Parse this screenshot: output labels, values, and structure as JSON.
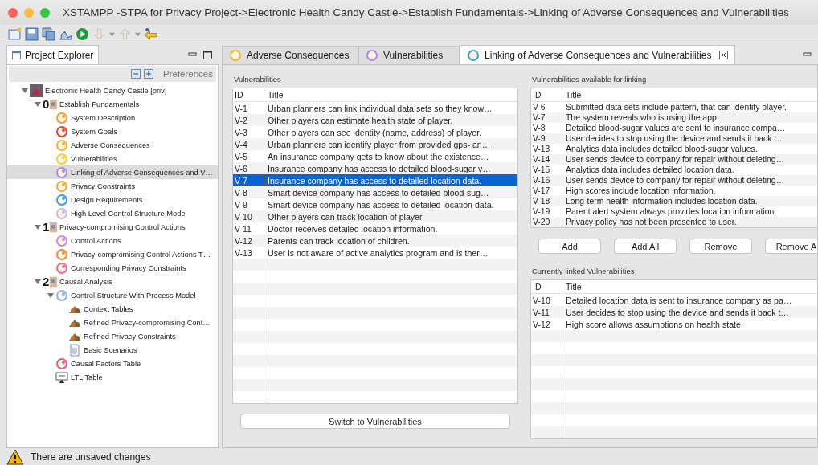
{
  "window": {
    "title": "XSTAMPP -STPA for Privacy Project->Electronic Health Candy Castle->Establish Fundamentals->Linking of Adverse Consequences and Vulnerabilities"
  },
  "project_explorer": {
    "title": "Project Explorer",
    "preferences": "Preferences",
    "tree": [
      {
        "label": "Electronic Health Candy Castle [priv]",
        "kind": "project",
        "expanded": true,
        "selected": false,
        "children": [
          {
            "label": "Establish Fundamentals",
            "kind": "phase",
            "number": "0",
            "expanded": true,
            "selected": false,
            "children": [
              {
                "label": "System Description",
                "kind": "step",
                "selected": false
              },
              {
                "label": "System Goals",
                "kind": "step",
                "selected": false
              },
              {
                "label": "Adverse Consequences",
                "kind": "step",
                "selected": false
              },
              {
                "label": "Vulnerabilities",
                "kind": "step",
                "selected": false
              },
              {
                "label": "Linking of Adverse Consequences and V…",
                "kind": "step",
                "selected": true
              },
              {
                "label": "Privacy Constraints",
                "kind": "step",
                "selected": false
              },
              {
                "label": "Design Requirements",
                "kind": "step",
                "selected": false
              },
              {
                "label": "High Level Control Structure Model",
                "kind": "step",
                "selected": false
              }
            ]
          },
          {
            "label": "Privacy-compromising Control Actions",
            "kind": "phase",
            "number": "1",
            "expanded": true,
            "selected": false,
            "children": [
              {
                "label": "Control Actions",
                "kind": "step",
                "selected": false
              },
              {
                "label": "Privacy-compromising Control Actions T…",
                "kind": "step",
                "selected": false
              },
              {
                "label": "Corresponding Privacy Constraints",
                "kind": "step",
                "selected": false
              }
            ]
          },
          {
            "label": "Causal Analysis",
            "kind": "phase",
            "number": "2",
            "expanded": true,
            "selected": false,
            "children": [
              {
                "label": "Control Structure With Process Model",
                "kind": "step",
                "expanded": true,
                "selected": false,
                "children": [
                  {
                    "label": "Context Tables",
                    "kind": "table",
                    "selected": false
                  },
                  {
                    "label": "Refined Privacy-compromising Cont…",
                    "kind": "table",
                    "selected": false
                  },
                  {
                    "label": "Refined Privacy Constraints",
                    "kind": "table",
                    "selected": false
                  },
                  {
                    "label": "Basic Scenarios",
                    "kind": "doc",
                    "selected": false
                  }
                ]
              },
              {
                "label": "Causal Factors Table",
                "kind": "step",
                "selected": false
              },
              {
                "label": "LTL Table",
                "kind": "board",
                "selected": false
              }
            ]
          }
        ]
      }
    ]
  },
  "editor_tabs": [
    {
      "label": "Adverse Consequences",
      "selected": false
    },
    {
      "label": "Vulnerabilities",
      "selected": false
    },
    {
      "label": "Linking of Adverse Consequences and Vulnerabilities",
      "selected": true
    }
  ],
  "vulnerabilities": {
    "label": "Vulnerabilities",
    "columns": [
      "ID",
      "Title"
    ],
    "rows": [
      {
        "id": "V-1",
        "title": "Urban planners can link individual data sets so they know…",
        "selected": false
      },
      {
        "id": "V-2",
        "title": "Other players can estimate health state of player.",
        "selected": false
      },
      {
        "id": "V-3",
        "title": "Other players can see identity (name, address) of player.",
        "selected": false
      },
      {
        "id": "V-4",
        "title": "Urban planners can identify player from provided gps- an…",
        "selected": false
      },
      {
        "id": "V-5",
        "title": "An insurance company gets to know about the existence…",
        "selected": false
      },
      {
        "id": "V-6",
        "title": "Insurance company has access to detailed blood-sugar v…",
        "selected": false
      },
      {
        "id": "V-7",
        "title": "Insurance company has access to detailed location data.",
        "selected": true
      },
      {
        "id": "V-8",
        "title": "Smart device company has access to detailed blood-sug…",
        "selected": false
      },
      {
        "id": "V-9",
        "title": "Smart device company has access to detailed location data.",
        "selected": false
      },
      {
        "id": "V-10",
        "title": "Other players can track location of player.",
        "selected": false
      },
      {
        "id": "V-11",
        "title": "Doctor receives detailed location information.",
        "selected": false
      },
      {
        "id": "V-12",
        "title": "Parents can track location of children.",
        "selected": false
      },
      {
        "id": "V-13",
        "title": "User is not aware of active analytics program and is ther…",
        "selected": false
      }
    ]
  },
  "switch_button": "Switch to Vulnerabilities",
  "available": {
    "label": "Vulnerabilities available for linking",
    "columns": [
      "ID",
      "Title"
    ],
    "rows": [
      {
        "id": "V-6",
        "title": "Submitted data sets include pattern, that can identify player."
      },
      {
        "id": "V-7",
        "title": "The system reveals who is using the app."
      },
      {
        "id": "V-8",
        "title": "Detailed blood-sugar values are sent to insurance compa…"
      },
      {
        "id": "V-9",
        "title": "User decides to stop using the device and sends it back t…"
      },
      {
        "id": "V-13",
        "title": "Analytics data includes detailed blood-sugar values."
      },
      {
        "id": "V-14",
        "title": "User sends device to company for repair without deleting…"
      },
      {
        "id": "V-15",
        "title": "Analytics data includes detailed location data."
      },
      {
        "id": "V-16",
        "title": "User sends device to company for repair without deleting…"
      },
      {
        "id": "V-17",
        "title": "High scores include location information."
      },
      {
        "id": "V-18",
        "title": "Long-term health information includes location data."
      },
      {
        "id": "V-19",
        "title": "Parent alert system always provides location information."
      },
      {
        "id": "V-20",
        "title": "Privacy policy has not been presented to user."
      }
    ]
  },
  "buttons": [
    "Add",
    "Add All",
    "Remove",
    "Remove A"
  ],
  "linked": {
    "label": "Currently linked Vulnerabilities",
    "columns": [
      "ID",
      "Title"
    ],
    "rows": [
      {
        "id": "V-10",
        "title": "Detailed location data is sent to insurance company as pa…"
      },
      {
        "id": "V-11",
        "title": "User decides to stop using the device and sends it back t…"
      },
      {
        "id": "V-12",
        "title": "High score allows assumptions on health state."
      }
    ]
  },
  "status_bar": {
    "message": "There are unsaved changes"
  }
}
